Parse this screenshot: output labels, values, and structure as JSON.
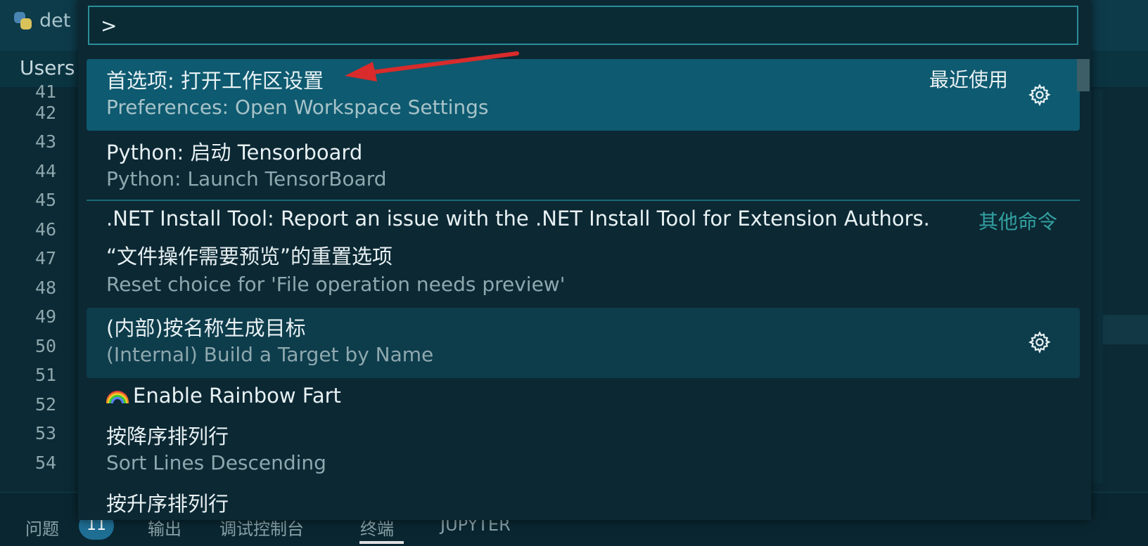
{
  "editor": {
    "tab_title": "det",
    "breadcrumb": "Users",
    "line_numbers": [
      "41",
      "42",
      "43",
      "44",
      "45",
      "46",
      "47",
      "48",
      "49",
      "50",
      "51",
      "52",
      "53",
      "54"
    ]
  },
  "panel": {
    "tabs": [
      "问题",
      "输出",
      "调试控制台",
      "终端",
      "JUPYTER"
    ],
    "problems_badge": "11"
  },
  "palette": {
    "input_value": ">",
    "items": [
      {
        "label": "首选项: 打开工作区设置",
        "detail": "Preferences: Open Workspace Settings",
        "group": "最近使用",
        "icon": "gear-icon",
        "state": "selected"
      },
      {
        "label": "Python: 启动 Tensorboard",
        "detail": "Python: Launch TensorBoard"
      },
      {
        "label": ".NET Install Tool: Report an issue with the .NET Install Tool for Extension Authors.",
        "group": "其他命令"
      },
      {
        "label": "“文件操作需要预览”的重置选项",
        "detail": "Reset choice for 'File operation needs preview'"
      },
      {
        "label": "(内部)按名称生成目标",
        "detail": "(Internal) Build a Target by Name",
        "icon": "gear-icon",
        "state": "hover"
      },
      {
        "label": "Enable Rainbow Fart",
        "icon": "rainbow-icon"
      },
      {
        "label": "按降序排列行",
        "detail": "Sort Lines Descending"
      },
      {
        "label": "按升序排列行"
      }
    ]
  },
  "colors": {
    "selected_bg": "#0e5a70",
    "hover_bg": "#0d3c4b",
    "input_border": "#2a8f9a",
    "group_other": "#33a0a0",
    "annotation_arrow": "#d92b2b"
  }
}
